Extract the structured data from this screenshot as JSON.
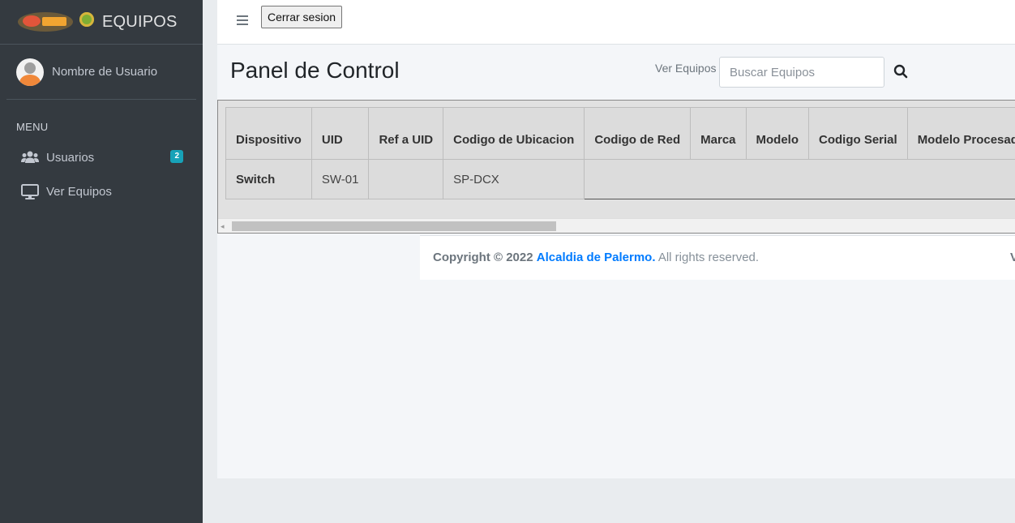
{
  "app": {
    "brand_text": "EQUIPOS"
  },
  "sidebar": {
    "user_name": "Nombre de Usuario",
    "menu_header": "MENU",
    "items": [
      {
        "label": "Usuarios",
        "icon": "users-icon",
        "badge": "2"
      },
      {
        "label": "Ver Equipos",
        "icon": "desktop-icon"
      }
    ]
  },
  "navbar": {
    "logout_label": "Cerrar sesion"
  },
  "main": {
    "title": "Panel de Control",
    "search_label": "Ver Equipos",
    "search_placeholder": "Buscar Equipos"
  },
  "table": {
    "headers": [
      "Dispositivo",
      "UID",
      "Ref a UID",
      "Codigo de Ubicacion",
      "Codigo de Red",
      "Marca",
      "Modelo",
      "Codigo Serial",
      "Modelo Procesador"
    ],
    "rows": [
      [
        "Switch",
        "SW-01",
        "",
        "SP-DCX"
      ]
    ]
  },
  "footer": {
    "copyright": "Copyright © 2022",
    "org": "Alcaldia de Palermo.",
    "rights": "All rights reserved.",
    "version": "V"
  },
  "colors": {
    "sidebar_bg": "#343a40",
    "accent": "#007bff",
    "badge": "#17a2b8"
  }
}
